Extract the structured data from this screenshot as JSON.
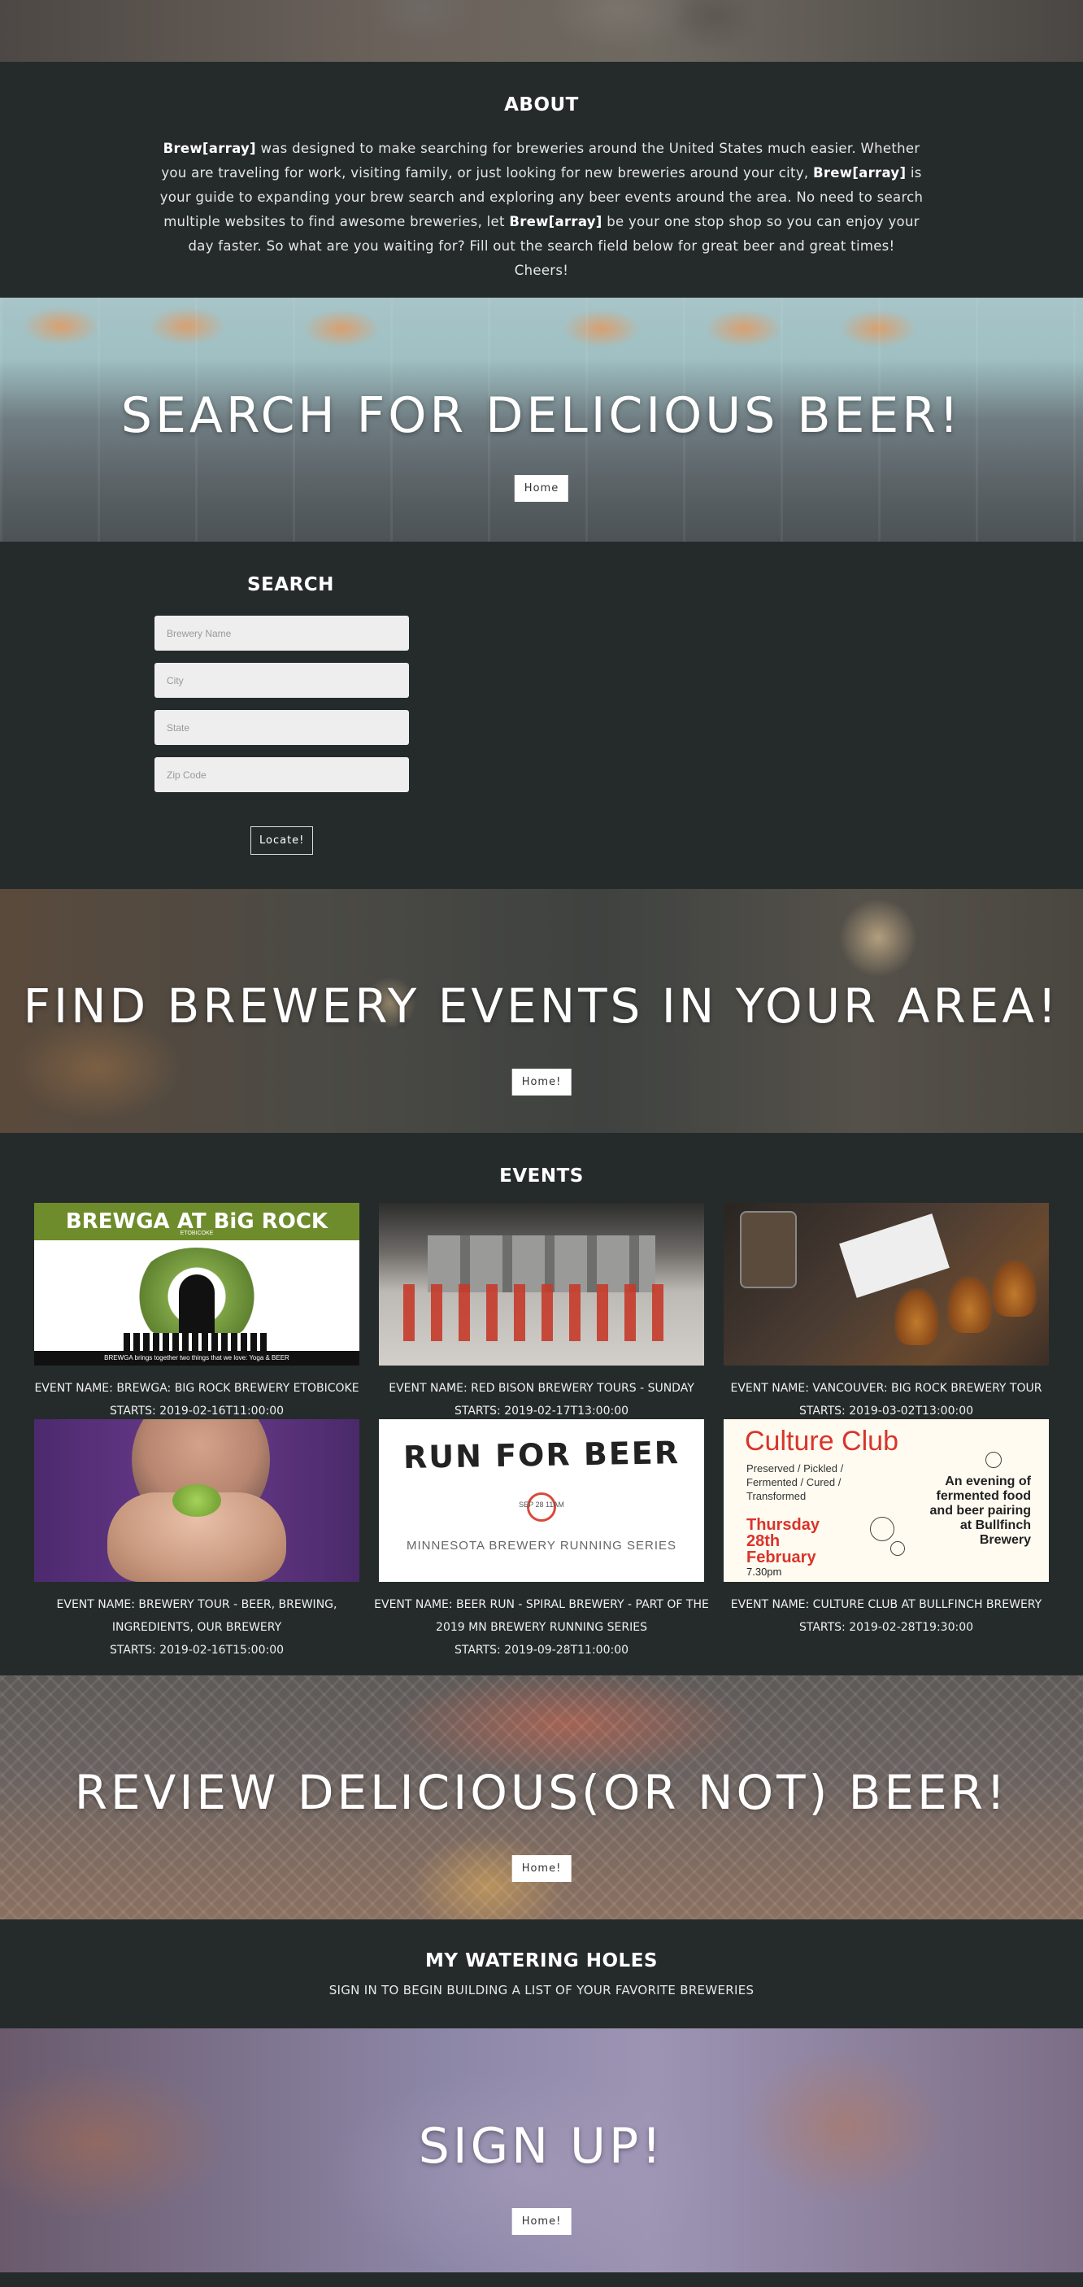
{
  "about": {
    "title": "ABOUT",
    "brand": "Brew[array]",
    "text_1": " was designed to make searching for breweries around the United States much easier. Whether you are traveling for work, visiting family, or just looking for new breweries around your city, ",
    "text_2": " is your guide to expanding your brew search and exploring any beer events around the area. No need to search multiple websites to find awesome breweries, let ",
    "text_3": " be your one stop shop so you can enjoy your day faster. So what are you waiting for? Fill out the search field below for great beer and great times! Cheers!"
  },
  "banners": {
    "search": {
      "heading": "SEARCH FOR DELICIOUS BEER!",
      "button": "Home"
    },
    "events": {
      "heading": "FIND BREWERY EVENTS IN YOUR AREA!",
      "button": "Home!"
    },
    "review": {
      "heading": "REVIEW DELICIOUS(OR NOT) BEER!",
      "button": "Home!"
    },
    "signup": {
      "heading": "SIGN UP!",
      "button": "Home!"
    }
  },
  "search": {
    "title": "SEARCH",
    "brewery_placeholder": "Brewery Name",
    "city_placeholder": "City",
    "state_placeholder": "State",
    "zip_placeholder": "Zip Code",
    "submit": "Locate!"
  },
  "events": {
    "title": "EVENTS",
    "items": [
      {
        "name": "EVENT NAME: BREWGA: BIG ROCK BREWERY ETOBICOKE",
        "starts": "STARTS: 2019-02-16T11:00:00"
      },
      {
        "name": "EVENT NAME: RED BISON BREWERY TOURS - SUNDAY",
        "starts": "STARTS: 2019-02-17T13:00:00"
      },
      {
        "name": "EVENT NAME: VANCOUVER: BIG ROCK BREWERY TOUR",
        "starts": "STARTS: 2019-03-02T13:00:00"
      },
      {
        "name": "EVENT NAME: BREWERY TOUR - BEER, BREWING, INGREDIENTS, OUR BREWERY",
        "starts": "STARTS: 2019-02-16T15:00:00"
      },
      {
        "name": "EVENT NAME: BEER RUN - SPIRAL BREWERY - PART OF THE 2019 MN BREWERY RUNNING SERIES",
        "starts": "STARTS: 2019-09-28T11:00:00"
      },
      {
        "name": "EVENT NAME: CULTURE CLUB AT BULLFINCH BREWERY",
        "starts": "STARTS: 2019-02-28T19:30:00"
      }
    ],
    "poster_text": {
      "brewga_title": "BREWGA AT BiG ROCK",
      "brewga_sub": "ETOBICOKE",
      "brewga_bar": "BREWGA brings together two things that we love: Yoga & BEER",
      "run_title": "RUN FOR BEER",
      "run_dates": "SEP 28                    11AM",
      "run_series": "MINNESOTA BREWERY RUNNING SERIES",
      "cc_title": "Culture Club",
      "cc_list": "Preserved / Pickled / Fermented / Cured / Transformed",
      "cc_date": "Thursday 28th February",
      "cc_time": "7.30pm",
      "cc_right": "An evening of fermented food and beer pairing at Bullfinch Brewery"
    }
  },
  "watering": {
    "title": "MY WATERING HOLES",
    "subtitle": "SIGN IN TO BEGIN BUILDING A LIST OF YOUR FAVORITE BREWERIES"
  }
}
